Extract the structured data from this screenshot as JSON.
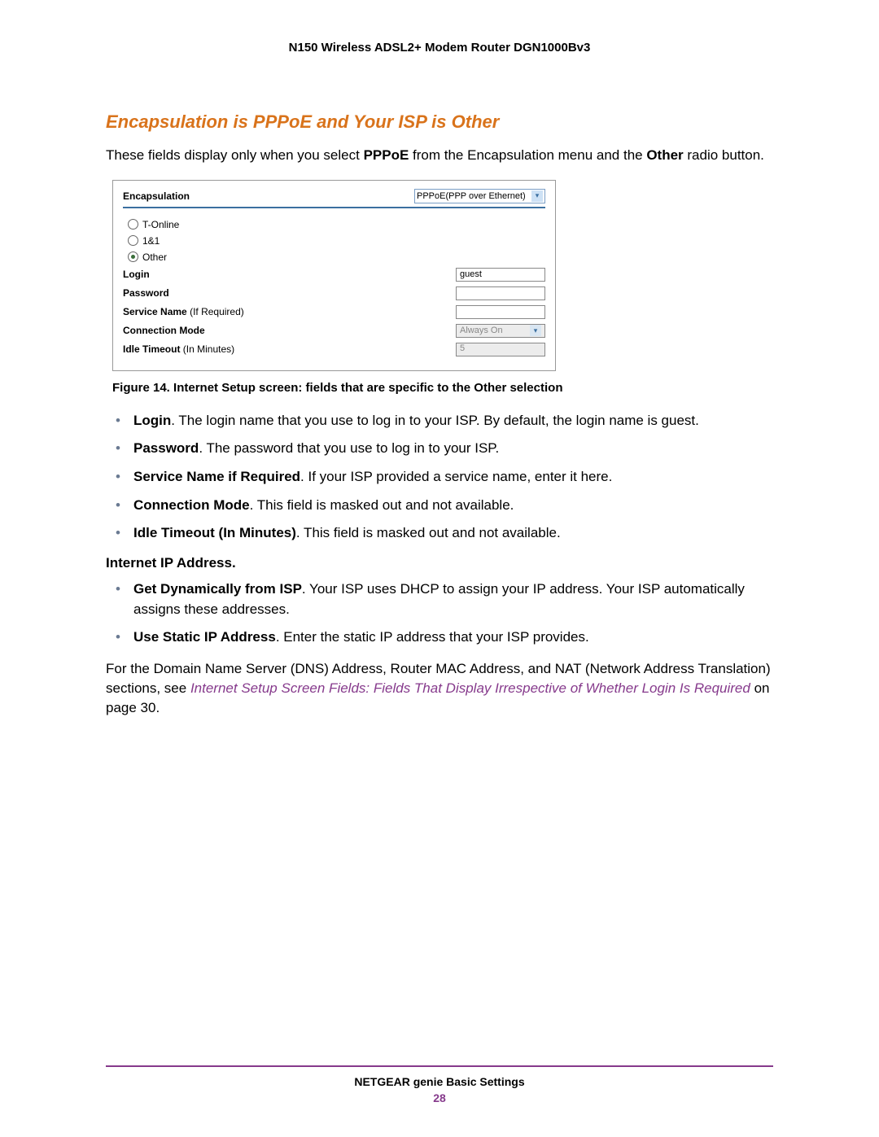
{
  "header": {
    "product": "N150 Wireless ADSL2+ Modem Router DGN1000Bv3"
  },
  "section": {
    "heading": "Encapsulation is PPPoE and Your ISP is Other"
  },
  "intro": {
    "pre": "These fields display only when you select ",
    "bold1": "PPPoE",
    "mid": " from the Encapsulation menu and the ",
    "bold2": "Other",
    "post": " radio button."
  },
  "figure": {
    "enc_label": "Encapsulation",
    "enc_value": "PPPoE(PPP over Ethernet)",
    "radios": [
      {
        "label": "T-Online",
        "selected": false
      },
      {
        "label": "1&1",
        "selected": false
      },
      {
        "label": "Other",
        "selected": true
      }
    ],
    "login_label": "Login",
    "login_value": "guest",
    "password_label": "Password",
    "password_value": "",
    "service_label_b": "Service Name",
    "service_label_p": " (If Required)",
    "service_value": "",
    "connmode_label": "Connection Mode",
    "connmode_value": "Always On",
    "idle_label_b": "Idle Timeout",
    "idle_label_p": " (In Minutes)",
    "idle_value": "5",
    "caption": "Figure 14. Internet Setup screen: fields that are specific to the Other selection"
  },
  "bullets1": [
    {
      "bold": "Login",
      "text": ". The login name that you use to log in to your ISP. By default, the login name is guest."
    },
    {
      "bold": "Password",
      "text": ". The password that you use to log in to your ISP."
    },
    {
      "bold": "Service Name if Required",
      "text": ". If your ISP provided a service name, enter it here."
    },
    {
      "bold": "Connection Mode",
      "text": ". This field is masked out and not available."
    },
    {
      "bold": "Idle Timeout (In Minutes)",
      "text": ". This field is masked out and not available."
    }
  ],
  "subhead": "Internet IP Address",
  "bullets2": [
    {
      "bold": "Get Dynamically from ISP",
      "text": ". Your ISP uses DHCP to assign your IP address. Your ISP automatically assigns these addresses."
    },
    {
      "bold": "Use Static IP Address",
      "text": ". Enter the static IP address that your ISP provides."
    }
  ],
  "closing": {
    "pre": "For the Domain Name Server (DNS) Address, Router MAC Address, and NAT (Network Address Translation) sections, see ",
    "link": "Internet Setup Screen Fields: Fields That Display Irrespective of Whether Login Is Required",
    "post": " on page 30."
  },
  "footer": {
    "title": "NETGEAR genie Basic Settings",
    "page": "28"
  }
}
